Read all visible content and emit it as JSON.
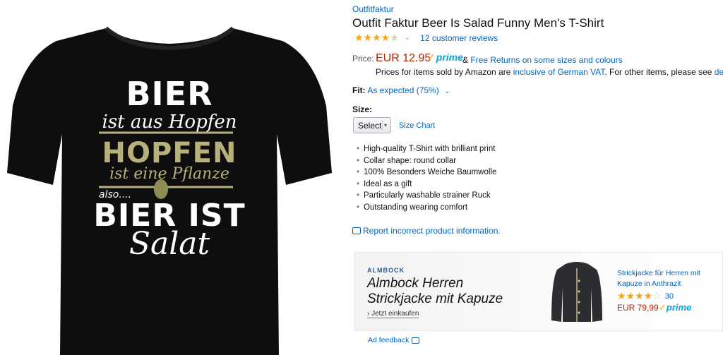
{
  "product_image": {
    "shirt_lines": [
      "BIER",
      "ist aus Hopfen",
      "HOPFEN",
      "ist eine Pflanze",
      "also....",
      "BIER IST",
      "Salat"
    ],
    "shirt_color": "#0e0e0e",
    "accent_color": "#b7b07a"
  },
  "product": {
    "brand": "Outfitfaktur",
    "title": "Outfit Faktur Beer Is Salad Funny Men's T-Shirt",
    "rating": 4.5,
    "reviews": "12 customer reviews",
    "price_label": "Price:",
    "price": "EUR 12.95",
    "prime": "prime",
    "returns_prefix": "& ",
    "returns_link": "Free Returns on some sizes and colours",
    "vat_prefix": "Prices for items sold by Amazon are ",
    "vat_link": "inclusive of German VAT",
    "vat_suffix": ". For other items, please see ",
    "details_link": "details",
    "vat_end": ".",
    "fit_label": "Fit:",
    "fit_value": "As expected (75%)",
    "size_label": "Size:",
    "size_select": "Select",
    "size_chart": "Size Chart",
    "bullets": [
      "High-quality T-Shirt with brilliant print",
      "Collar shape: round collar",
      "100% Besonders Weiche Baumwolle",
      "Ideal as a gift",
      "Particularly washable strainer Ruck",
      "Outstanding wearing comfort"
    ],
    "report": "Report incorrect product information."
  },
  "ad": {
    "brand": "ALMBOCK",
    "headline_1": "Almbock Herren",
    "headline_2": "Strickjacke mit Kapuze",
    "cta": "Jetzt einkaufen",
    "cta_prefix": "›",
    "product_name": "Strickjacke für Herren mit Kapuze in Anthrazit",
    "rating": 4.5,
    "review_count": "30",
    "price": "EUR 79,99",
    "prime": "prime",
    "feedback": "Ad feedback"
  },
  "colors": {
    "link": "#0066c0",
    "price": "#b12704",
    "star": "#f4a41d",
    "prime": "#00a8e1"
  }
}
